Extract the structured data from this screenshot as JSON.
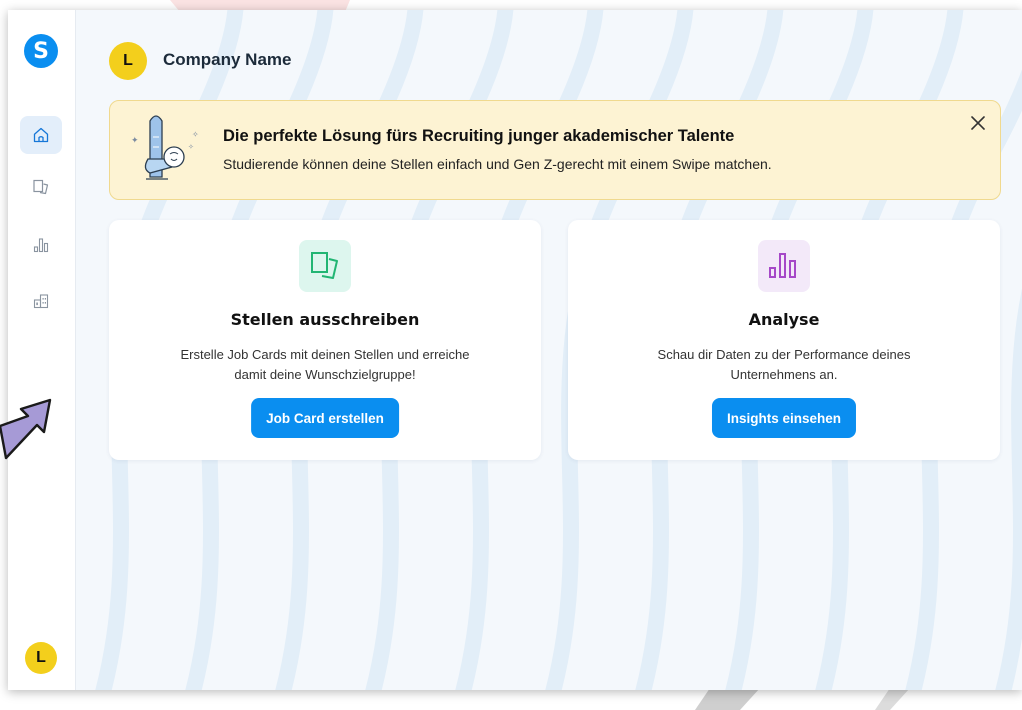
{
  "app": {
    "logo_letter": "S",
    "accent_color": "#0a8ef0"
  },
  "sidebar": {
    "items": [
      {
        "icon": "home-icon",
        "active": true
      },
      {
        "icon": "job-cards-icon",
        "active": false
      },
      {
        "icon": "analytics-icon",
        "active": false
      },
      {
        "icon": "company-icon",
        "active": false
      }
    ],
    "user_initial": "L"
  },
  "header": {
    "company_initial": "L",
    "company_name": "Company Name"
  },
  "banner": {
    "title": "Die perfekte Lösung fürs Recruiting junger akademischer Talente",
    "subtitle": "Studierende können deine Stellen einfach und Gen Z-gerecht mit einem Swipe matchen.",
    "close_icon": "close-icon"
  },
  "cards": [
    {
      "icon": "job-cards-icon",
      "title": "Stellen ausschreiben",
      "desc_line1": "Erstelle Job Cards mit deinen Stellen und erreiche",
      "desc_line2": "damit deine Wunschzielgruppe!",
      "button": "Job Card erstellen"
    },
    {
      "icon": "bar-chart-icon",
      "title": "Analyse",
      "desc_line1": "Schau dir Daten zu der Performance deines",
      "desc_line2": "Unternehmens an.",
      "button": "Insights einsehen"
    }
  ]
}
